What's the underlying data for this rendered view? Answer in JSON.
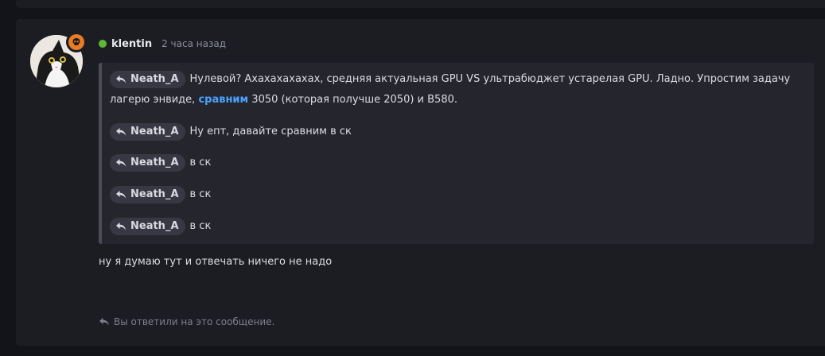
{
  "post": {
    "author": "klentin",
    "time": "2 часа назад",
    "quotes": [
      {
        "author": "Neath_A",
        "text_before": "Нулевой? Ахахахахахах, средняя актуальная GPU VS ультрабюджет устарелая GPU. Ладно. Упростим задачу лагерю энвиде, ",
        "link": "сравним",
        "text_after": " 3050 (которая получше 2050) и B580."
      },
      {
        "author": "Neath_A",
        "text": "Ну епт, давайте сравним в ск"
      },
      {
        "author": "Neath_A",
        "text": "в ск"
      },
      {
        "author": "Neath_A",
        "text": "в ск"
      },
      {
        "author": "Neath_A",
        "text": "в ск"
      }
    ],
    "body": "ну я думаю тут и отвечать ничего не надо",
    "reply_note": "Вы ответили на это сообщение."
  },
  "colors": {
    "page_bg": "#131419",
    "card_bg": "#1c1d23",
    "quote_bg": "#25262d",
    "link": "#4aa3ff",
    "online": "#5fb832",
    "badge": "#e87c22"
  },
  "icons": [
    "reply-arrow-icon",
    "skull-icon",
    "online-status-icon"
  ]
}
